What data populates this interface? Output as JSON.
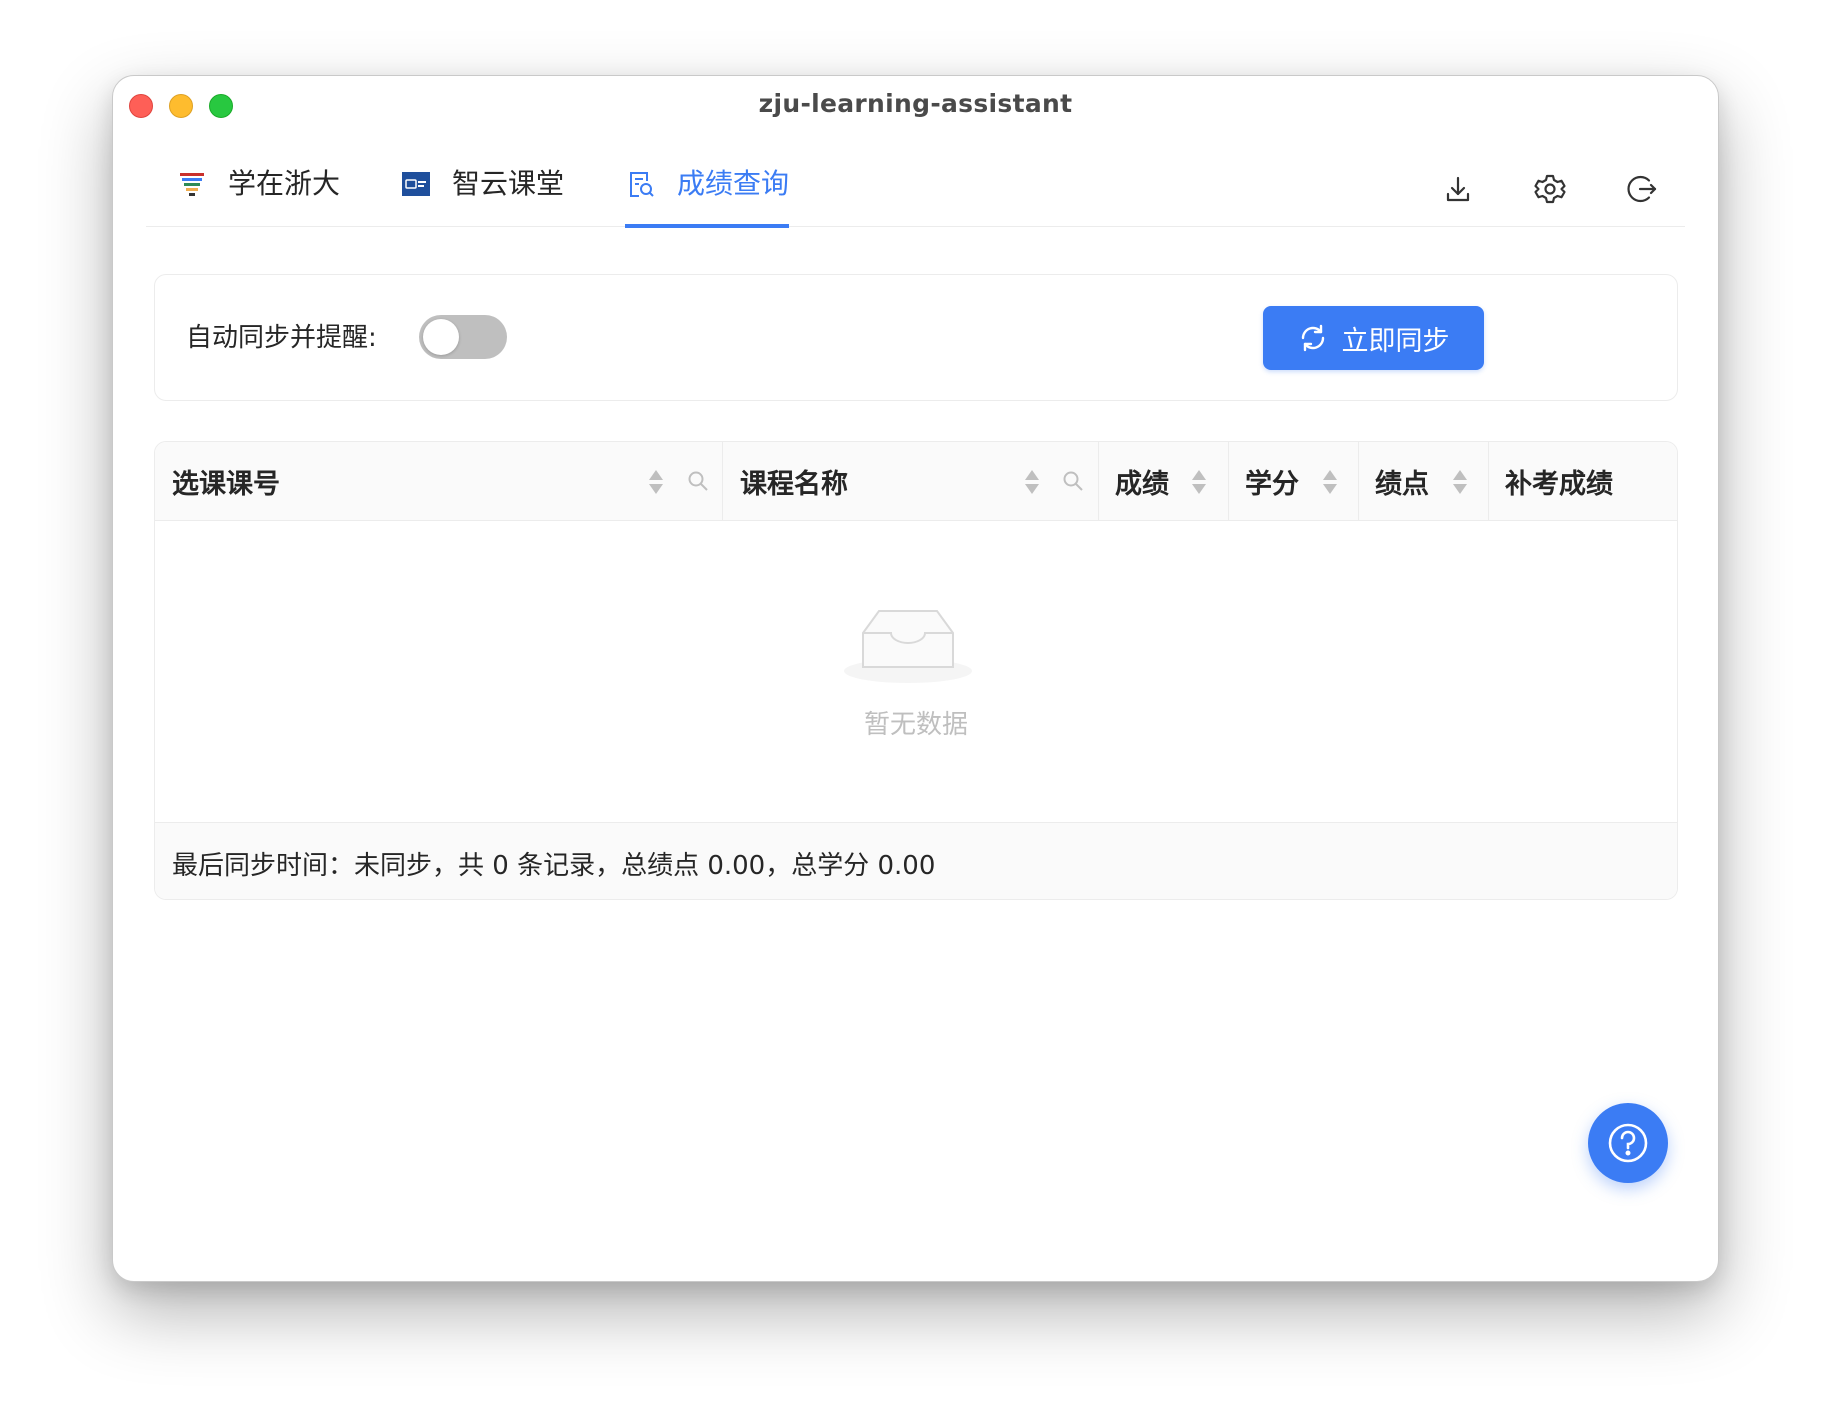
{
  "window": {
    "title": "zju-learning-assistant"
  },
  "tabs": [
    {
      "label": "学在浙大",
      "icon": "zju-logo-icon",
      "active": false
    },
    {
      "label": "智云课堂",
      "icon": "zhiyun-logo-icon",
      "active": false
    },
    {
      "label": "成绩查询",
      "icon": "grade-search-icon",
      "active": true
    }
  ],
  "toolbar": {
    "icons": [
      "download-icon",
      "settings-icon",
      "logout-icon"
    ]
  },
  "sync_panel": {
    "auto_sync_label": "自动同步并提醒:",
    "auto_sync_enabled": false,
    "sync_button_label": "立即同步",
    "sync_button_icon": "sync-icon"
  },
  "table": {
    "columns": [
      {
        "label": "选课课号",
        "sortable": true,
        "filterable": true
      },
      {
        "label": "课程名称",
        "sortable": true,
        "filterable": true
      },
      {
        "label": "成绩",
        "sortable": true,
        "filterable": false
      },
      {
        "label": "学分",
        "sortable": true,
        "filterable": false
      },
      {
        "label": "绩点",
        "sortable": true,
        "filterable": false
      },
      {
        "label": "补考成绩",
        "sortable": false,
        "filterable": false
      }
    ],
    "rows": [],
    "empty_text": "暂无数据",
    "footer": "最后同步时间：未同步，共 0 条记录，总绩点 0.00，总学分 0.00"
  },
  "help_button": {
    "icon": "help-icon"
  },
  "colors": {
    "accent": "#3b7cf4",
    "toggle_off": "#bfbfbf"
  }
}
